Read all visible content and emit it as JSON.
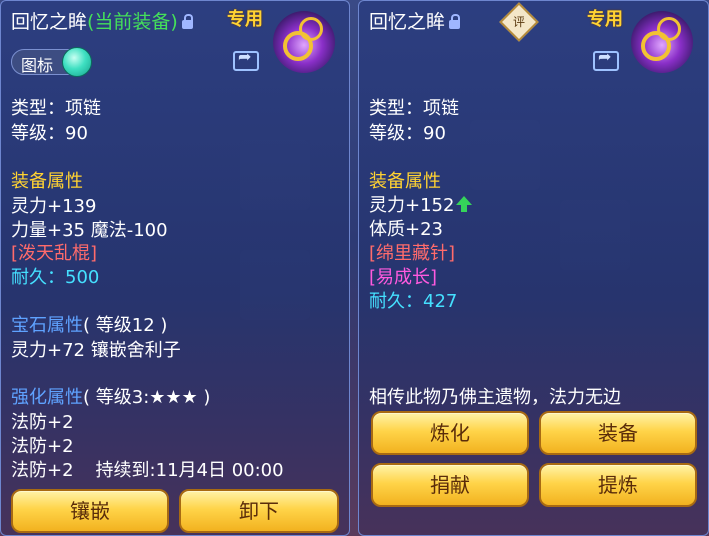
{
  "left": {
    "title": "回忆之眸",
    "title_equipped": "(当前装备)",
    "exclusive": "专用",
    "icon_toggle_label": "图标",
    "type_line": "类型：项链",
    "level_line": "等级：90",
    "equip_attr_header": "装备属性",
    "stat1": "灵力+139",
    "stat2": "力量+35 魔法-100",
    "special": "[泼天乱棍]",
    "durability_label": "耐久：",
    "durability_value": "500",
    "gem_header": "宝石属性",
    "gem_level": "( 等级12 )",
    "gem_stat": "灵力+72 镶嵌舍利子",
    "enhance_header": "强化属性",
    "enhance_level": "( 等级3:★★★ )",
    "enhance1": "法防+2",
    "enhance2": "法防+2",
    "enhance3": "法防+2",
    "duration": "持续到:11月4日 00:00",
    "buttons": [
      "镶嵌",
      "卸下"
    ]
  },
  "right": {
    "title": "回忆之眸",
    "rating_label": "评",
    "exclusive": "专用",
    "type_line": "类型：项链",
    "level_line": "等级：90",
    "equip_attr_header": "装备属性",
    "stat1": "灵力+152",
    "stat2": "体质+23",
    "special1": "[绵里藏针]",
    "special2": "[易成长]",
    "durability_label": "耐久：",
    "durability_value": "427",
    "description": "相传此物乃佛主遗物，法力无边",
    "buttons": [
      "炼化",
      "装备",
      "捐献",
      "提炼"
    ]
  },
  "icons": [
    "lock-icon",
    "share-icon",
    "necklace-icon",
    "rating-icon",
    "arrow-up-icon"
  ],
  "colors": {
    "gold_button": "#ffd449",
    "equipped_green": "#44e05a",
    "attr_yellow": "#ffd232",
    "gem_blue": "#5fa2ff",
    "special_red": "#ff6b6b",
    "special_pink": "#ff5adf",
    "durability_cyan": "#45e0ff"
  }
}
